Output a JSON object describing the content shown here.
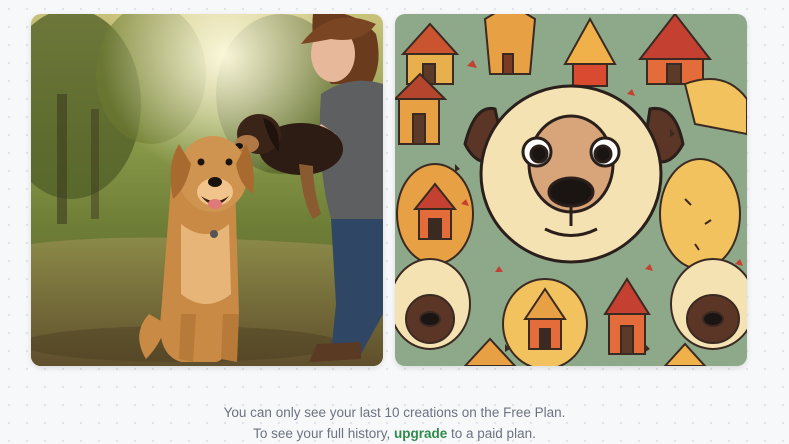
{
  "gallery": {
    "items": [
      {
        "alt": "Dog and child in a sunny park",
        "icon": "photo"
      },
      {
        "alt": "Cartoon dog face surrounded by little houses",
        "icon": "illustration"
      }
    ]
  },
  "notice": {
    "line1": "You can only see your last 10 creations on the Free Plan.",
    "line2_before": "To see your full history,",
    "upgrade_label": "upgrade",
    "line2_after": "to a paid plan."
  },
  "colors": {
    "upgrade_link": "#2e8b4a",
    "notice_text": "#6b7280",
    "background": "#f7f8fa"
  }
}
